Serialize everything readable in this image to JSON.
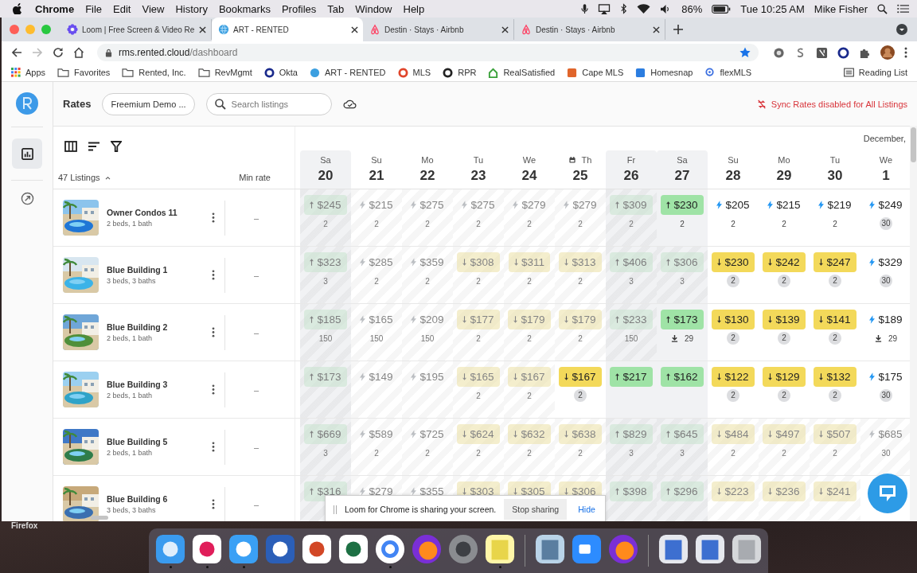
{
  "menu_bar": {
    "app": "Chrome",
    "items": [
      "File",
      "Edit",
      "View",
      "History",
      "Bookmarks",
      "Profiles",
      "Tab",
      "Window",
      "Help"
    ],
    "battery": "86%",
    "clock": "Tue 10:25 AM",
    "user": "Mike Fisher"
  },
  "tabs": [
    {
      "title": "Loom | Free Screen & Video Re",
      "kind": "loom",
      "selected": false
    },
    {
      "title": "ART - RENTED",
      "kind": "rented",
      "selected": true
    },
    {
      "title": "Destin · Stays · Airbnb",
      "kind": "airbnb",
      "selected": false
    },
    {
      "title": "Destin · Stays · Airbnb",
      "kind": "airbnb",
      "selected": false
    }
  ],
  "address": {
    "host": "rms.rented.cloud",
    "path": "/dashboard"
  },
  "bookmarks": [
    {
      "label": "Apps",
      "kind": "apps"
    },
    {
      "label": "Favorites",
      "kind": "folder"
    },
    {
      "label": "Rented, Inc.",
      "kind": "folder"
    },
    {
      "label": "RevMgmt",
      "kind": "folder"
    },
    {
      "label": "Okta",
      "kind": "ring",
      "color": "#1a2a8c"
    },
    {
      "label": "ART - RENTED",
      "kind": "globe",
      "color": "#3b9fe0"
    },
    {
      "label": "MLS",
      "kind": "ring",
      "color": "#e0452b"
    },
    {
      "label": "RPR",
      "kind": "ring",
      "color": "#222222"
    },
    {
      "label": "RealSatisfied",
      "kind": "house",
      "color": "#3aa13a"
    },
    {
      "label": "Cape MLS",
      "kind": "square",
      "color": "#e0652b"
    },
    {
      "label": "Homesnap",
      "kind": "square",
      "color": "#2b7de0"
    },
    {
      "label": "flexMLS",
      "kind": "pin",
      "color": "#3b6fe0"
    }
  ],
  "reading_list": "Reading List",
  "app": {
    "title": "Rates",
    "account": "Freemium Demo ...",
    "search_placeholder": "Search listings",
    "sync_warning": "Sync Rates disabled for All Listings",
    "month": "December,",
    "listings_count": "47 Listings",
    "min_rate_header": "Min rate",
    "days": [
      {
        "dow": "Sa",
        "date": "20",
        "shaded": true,
        "event": false
      },
      {
        "dow": "Su",
        "date": "21",
        "shaded": false,
        "event": false
      },
      {
        "dow": "Mo",
        "date": "22",
        "shaded": false,
        "event": false
      },
      {
        "dow": "Tu",
        "date": "23",
        "shaded": false,
        "event": false
      },
      {
        "dow": "We",
        "date": "24",
        "shaded": false,
        "event": false
      },
      {
        "dow": "Th",
        "date": "25",
        "shaded": false,
        "event": true
      },
      {
        "dow": "Fr",
        "date": "26",
        "shaded": true,
        "event": false
      },
      {
        "dow": "Sa",
        "date": "27",
        "shaded": true,
        "event": false
      },
      {
        "dow": "Su",
        "date": "28",
        "shaded": false,
        "event": false
      },
      {
        "dow": "Mo",
        "date": "29",
        "shaded": false,
        "event": false
      },
      {
        "dow": "Tu",
        "date": "30",
        "shaded": false,
        "event": false
      },
      {
        "dow": "We",
        "date": "1",
        "shaded": false,
        "event": false
      }
    ],
    "rows": [
      {
        "name": "Owner Condos 11",
        "details": "2 beds, 1 bath",
        "min_rate": "–",
        "cells": [
          {
            "kind": "up",
            "price": "$245",
            "count": "2",
            "highlighted": true,
            "faded": true,
            "badge": false
          },
          {
            "kind": "bolt",
            "price": "$215",
            "count": "2",
            "highlighted": false,
            "faded": true,
            "badge": false
          },
          {
            "kind": "bolt",
            "price": "$275",
            "count": "2",
            "highlighted": false,
            "faded": true,
            "badge": false
          },
          {
            "kind": "bolt",
            "price": "$275",
            "count": "2",
            "highlighted": false,
            "faded": true,
            "badge": false
          },
          {
            "kind": "bolt",
            "price": "$279",
            "count": "2",
            "highlighted": false,
            "faded": true,
            "badge": false
          },
          {
            "kind": "bolt",
            "price": "$279",
            "count": "2",
            "highlighted": false,
            "faded": true,
            "badge": false
          },
          {
            "kind": "up",
            "price": "$309",
            "count": "2",
            "highlighted": true,
            "faded": true,
            "badge": false
          },
          {
            "kind": "up",
            "price": "$230",
            "count": "2",
            "highlighted": true,
            "faded": false,
            "badge": false
          },
          {
            "kind": "bolt",
            "price": "$205",
            "count": "2",
            "highlighted": false,
            "faded": false,
            "badge": false
          },
          {
            "kind": "bolt",
            "price": "$215",
            "count": "2",
            "highlighted": false,
            "faded": false,
            "badge": false
          },
          {
            "kind": "bolt",
            "price": "$219",
            "count": "2",
            "highlighted": false,
            "faded": false,
            "badge": false
          },
          {
            "kind": "bolt",
            "price": "$249",
            "count": "30",
            "highlighted": false,
            "faded": false,
            "badge": true
          }
        ]
      },
      {
        "name": "Blue Building 1",
        "details": "3 beds, 3 baths",
        "min_rate": "–",
        "cells": [
          {
            "kind": "up",
            "price": "$323",
            "count": "3",
            "highlighted": true,
            "faded": true,
            "badge": false
          },
          {
            "kind": "bolt",
            "price": "$285",
            "count": "2",
            "highlighted": false,
            "faded": true,
            "badge": false
          },
          {
            "kind": "bolt",
            "price": "$359",
            "count": "2",
            "highlighted": false,
            "faded": true,
            "badge": false
          },
          {
            "kind": "down",
            "price": "$308",
            "count": "2",
            "highlighted": true,
            "faded": true,
            "badge": false
          },
          {
            "kind": "down",
            "price": "$311",
            "count": "2",
            "highlighted": true,
            "faded": true,
            "badge": false
          },
          {
            "kind": "down",
            "price": "$313",
            "count": "2",
            "highlighted": true,
            "faded": true,
            "badge": false
          },
          {
            "kind": "up",
            "price": "$406",
            "count": "3",
            "highlighted": true,
            "faded": true,
            "badge": false
          },
          {
            "kind": "up",
            "price": "$306",
            "count": "3",
            "highlighted": true,
            "faded": true,
            "badge": false
          },
          {
            "kind": "down",
            "price": "$230",
            "count": "2",
            "highlighted": true,
            "faded": false,
            "badge": true
          },
          {
            "kind": "down",
            "price": "$242",
            "count": "2",
            "highlighted": true,
            "faded": false,
            "badge": true
          },
          {
            "kind": "down",
            "price": "$247",
            "count": "2",
            "highlighted": true,
            "faded": false,
            "badge": true
          },
          {
            "kind": "bolt",
            "price": "$329",
            "count": "30",
            "highlighted": false,
            "faded": false,
            "badge": true
          }
        ]
      },
      {
        "name": "Blue Building 2",
        "details": "2 beds, 1 bath",
        "min_rate": "–",
        "cells": [
          {
            "kind": "up",
            "price": "$185",
            "count": "150",
            "highlighted": true,
            "faded": true,
            "badge": false
          },
          {
            "kind": "bolt",
            "price": "$165",
            "count": "150",
            "highlighted": false,
            "faded": true,
            "badge": false
          },
          {
            "kind": "bolt",
            "price": "$209",
            "count": "150",
            "highlighted": false,
            "faded": true,
            "badge": false
          },
          {
            "kind": "down",
            "price": "$177",
            "count": "2",
            "highlighted": true,
            "faded": true,
            "badge": false
          },
          {
            "kind": "down",
            "price": "$179",
            "count": "2",
            "highlighted": true,
            "faded": true,
            "badge": false
          },
          {
            "kind": "down",
            "price": "$179",
            "count": "2",
            "highlighted": true,
            "faded": true,
            "badge": false
          },
          {
            "kind": "up",
            "price": "$233",
            "count": "150",
            "highlighted": true,
            "faded": true,
            "badge": false
          },
          {
            "kind": "up",
            "price": "$173",
            "count": "29",
            "highlighted": true,
            "faded": false,
            "badge": false,
            "download": true
          },
          {
            "kind": "down",
            "price": "$130",
            "count": "2",
            "highlighted": true,
            "faded": false,
            "badge": true
          },
          {
            "kind": "down",
            "price": "$139",
            "count": "2",
            "highlighted": true,
            "faded": false,
            "badge": true
          },
          {
            "kind": "down",
            "price": "$141",
            "count": "2",
            "highlighted": true,
            "faded": false,
            "badge": true
          },
          {
            "kind": "bolt",
            "price": "$189",
            "count": "29",
            "highlighted": false,
            "faded": false,
            "badge": false,
            "download": true
          }
        ]
      },
      {
        "name": "Blue Building 3",
        "details": "2 beds, 1 bath",
        "min_rate": "–",
        "cells": [
          {
            "kind": "up",
            "price": "$173",
            "highlighted": true,
            "faded": true
          },
          {
            "kind": "bolt",
            "price": "$149",
            "highlighted": false,
            "faded": true
          },
          {
            "kind": "bolt",
            "price": "$195",
            "highlighted": false,
            "faded": true
          },
          {
            "kind": "down",
            "price": "$165",
            "count": "2",
            "highlighted": true,
            "faded": true,
            "badge": false
          },
          {
            "kind": "down",
            "price": "$167",
            "count": "2",
            "highlighted": true,
            "faded": true,
            "badge": false
          },
          {
            "kind": "down",
            "price": "$167",
            "count": "2",
            "highlighted": true,
            "faded": false,
            "badge": true
          },
          {
            "kind": "up",
            "price": "$217",
            "highlighted": true,
            "faded": false
          },
          {
            "kind": "up",
            "price": "$162",
            "highlighted": true,
            "faded": false
          },
          {
            "kind": "down",
            "price": "$122",
            "count": "2",
            "highlighted": true,
            "faded": false,
            "badge": true
          },
          {
            "kind": "down",
            "price": "$129",
            "count": "2",
            "highlighted": true,
            "faded": false,
            "badge": true
          },
          {
            "kind": "down",
            "price": "$132",
            "count": "2",
            "highlighted": true,
            "faded": false,
            "badge": true
          },
          {
            "kind": "bolt",
            "price": "$175",
            "count": "30",
            "highlighted": false,
            "faded": false,
            "badge": true
          }
        ]
      },
      {
        "name": "Blue Building 5",
        "details": "2 beds, 1 bath",
        "min_rate": "–",
        "cells": [
          {
            "kind": "up",
            "price": "$669",
            "count": "3",
            "highlighted": true,
            "faded": true,
            "badge": false
          },
          {
            "kind": "bolt",
            "price": "$589",
            "count": "2",
            "highlighted": false,
            "faded": true,
            "badge": false
          },
          {
            "kind": "bolt",
            "price": "$725",
            "count": "2",
            "highlighted": false,
            "faded": true,
            "badge": false
          },
          {
            "kind": "down",
            "price": "$624",
            "count": "2",
            "highlighted": true,
            "faded": true,
            "badge": false
          },
          {
            "kind": "down",
            "price": "$632",
            "count": "2",
            "highlighted": true,
            "faded": true,
            "badge": false
          },
          {
            "kind": "down",
            "price": "$638",
            "count": "2",
            "highlighted": true,
            "faded": true,
            "badge": false
          },
          {
            "kind": "up",
            "price": "$829",
            "count": "3",
            "highlighted": true,
            "faded": true,
            "badge": false
          },
          {
            "kind": "up",
            "price": "$645",
            "count": "3",
            "highlighted": true,
            "faded": true,
            "badge": false
          },
          {
            "kind": "down",
            "price": "$484",
            "count": "2",
            "highlighted": true,
            "faded": true,
            "badge": false
          },
          {
            "kind": "down",
            "price": "$497",
            "count": "2",
            "highlighted": true,
            "faded": true,
            "badge": false
          },
          {
            "kind": "down",
            "price": "$507",
            "count": "2",
            "highlighted": true,
            "faded": true,
            "badge": false
          },
          {
            "kind": "bolt",
            "price": "$685",
            "count": "30",
            "highlighted": false,
            "faded": true,
            "badge": false
          }
        ]
      },
      {
        "name": "Blue Building 6",
        "details": "3 beds, 3 baths",
        "min_rate": "–",
        "cells": [
          {
            "kind": "up",
            "price": "$316",
            "highlighted": true,
            "faded": true
          },
          {
            "kind": "bolt",
            "price": "$279",
            "highlighted": false,
            "faded": true
          },
          {
            "kind": "bolt",
            "price": "$355",
            "highlighted": false,
            "faded": true
          },
          {
            "kind": "down",
            "price": "$303",
            "highlighted": true,
            "faded": true
          },
          {
            "kind": "down",
            "price": "$305",
            "highlighted": true,
            "faded": true
          },
          {
            "kind": "down",
            "price": "$306",
            "highlighted": true,
            "faded": true
          },
          {
            "kind": "up",
            "price": "$398",
            "highlighted": true,
            "faded": true
          },
          {
            "kind": "up",
            "price": "$296",
            "highlighted": true,
            "faded": true
          },
          {
            "kind": "down",
            "price": "$223",
            "highlighted": true,
            "faded": true
          },
          {
            "kind": "down",
            "price": "$236",
            "highlighted": true,
            "faded": true
          },
          {
            "kind": "down",
            "price": "$241",
            "highlighted": true,
            "faded": true
          }
        ]
      }
    ]
  },
  "loom_bar": {
    "message": "Loom for Chrome is sharing your screen.",
    "stop": "Stop sharing",
    "hide": "Hide"
  },
  "desktop_label": "Firefox",
  "dock": [
    {
      "kind": "finder",
      "running": true
    },
    {
      "kind": "slack",
      "running": true
    },
    {
      "kind": "messages",
      "running": true
    },
    {
      "kind": "word",
      "running": false
    },
    {
      "kind": "powerpoint",
      "running": false
    },
    {
      "kind": "excel",
      "running": false
    },
    {
      "kind": "chrome",
      "running": true
    },
    {
      "kind": "firefox",
      "running": false
    },
    {
      "kind": "settings",
      "running": false
    },
    {
      "kind": "notes",
      "running": true
    },
    {
      "kind": "divider"
    },
    {
      "kind": "preview",
      "running": false
    },
    {
      "kind": "zoom",
      "running": false
    },
    {
      "kind": "firefox",
      "running": false
    },
    {
      "kind": "divider"
    },
    {
      "kind": "window",
      "running": false
    },
    {
      "kind": "window",
      "running": false
    },
    {
      "kind": "trash",
      "running": false
    }
  ]
}
